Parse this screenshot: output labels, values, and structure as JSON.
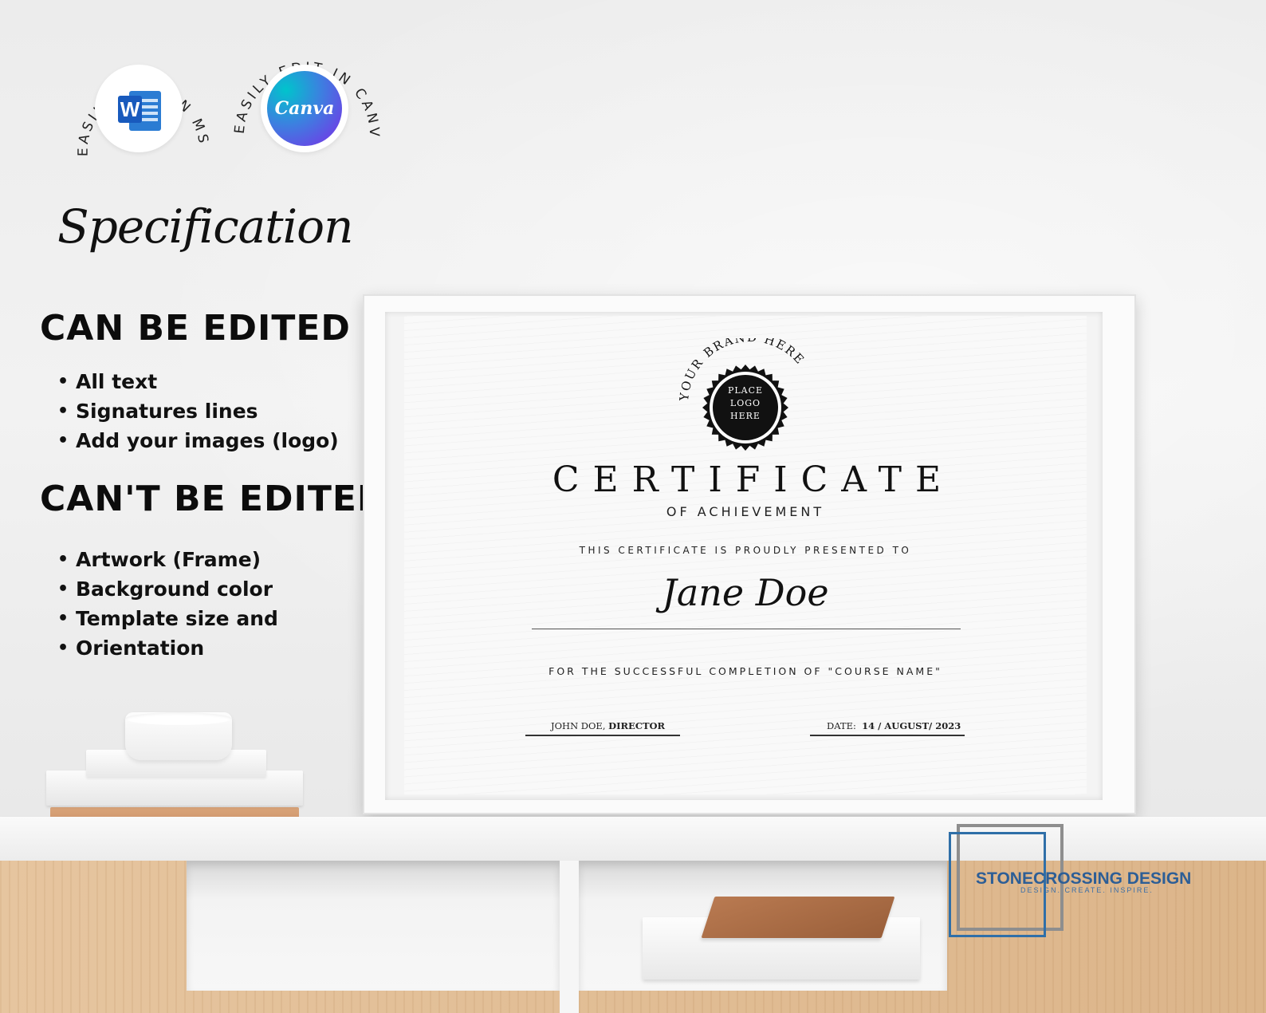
{
  "badges": {
    "word": {
      "arc_text": "EASILY EDIT IN MS WORD",
      "icon_letter": "W"
    },
    "canva": {
      "arc_text": "EASILY EDIT IN CANVA",
      "icon_text": "Canva"
    }
  },
  "specification": {
    "title": "Specification",
    "can_edit_heading": "CAN BE EDITED",
    "can_edit_items": [
      "All text",
      "Signatures lines",
      "Add your images (logo)"
    ],
    "cant_edit_heading": "CAN'T BE EDITED",
    "cant_edit_items": [
      "Artwork (Frame)",
      "Background color",
      "Template size and",
      "Orientation"
    ]
  },
  "certificate": {
    "brand_arc": "YOUR BRAND HERE",
    "seal_lines": [
      "PLACE",
      "LOGO",
      "HERE"
    ],
    "title": "CERTIFICATE",
    "subtitle": "OF ACHIEVEMENT",
    "presented": "THIS CERTIFICATE IS PROUDLY PRESENTED TO",
    "recipient": "Jane Doe",
    "completion": "FOR THE SUCCESSFUL COMPLETION OF \"COURSE NAME\"",
    "signer_name": "JOHN DOE,",
    "signer_role": "DIRECTOR",
    "date_label": "DATE:",
    "date_value": "14 / AUGUST/ 2023"
  },
  "watermark": {
    "brand": "STONECROSSING DESIGN",
    "tagline": "DESIGN. CREATE. INSPIRE."
  },
  "colors": {
    "word_blue": "#185abd",
    "canva_gradient": [
      "#00c4cc",
      "#7d2ae8"
    ],
    "logo_blue": "#2d5e96"
  }
}
